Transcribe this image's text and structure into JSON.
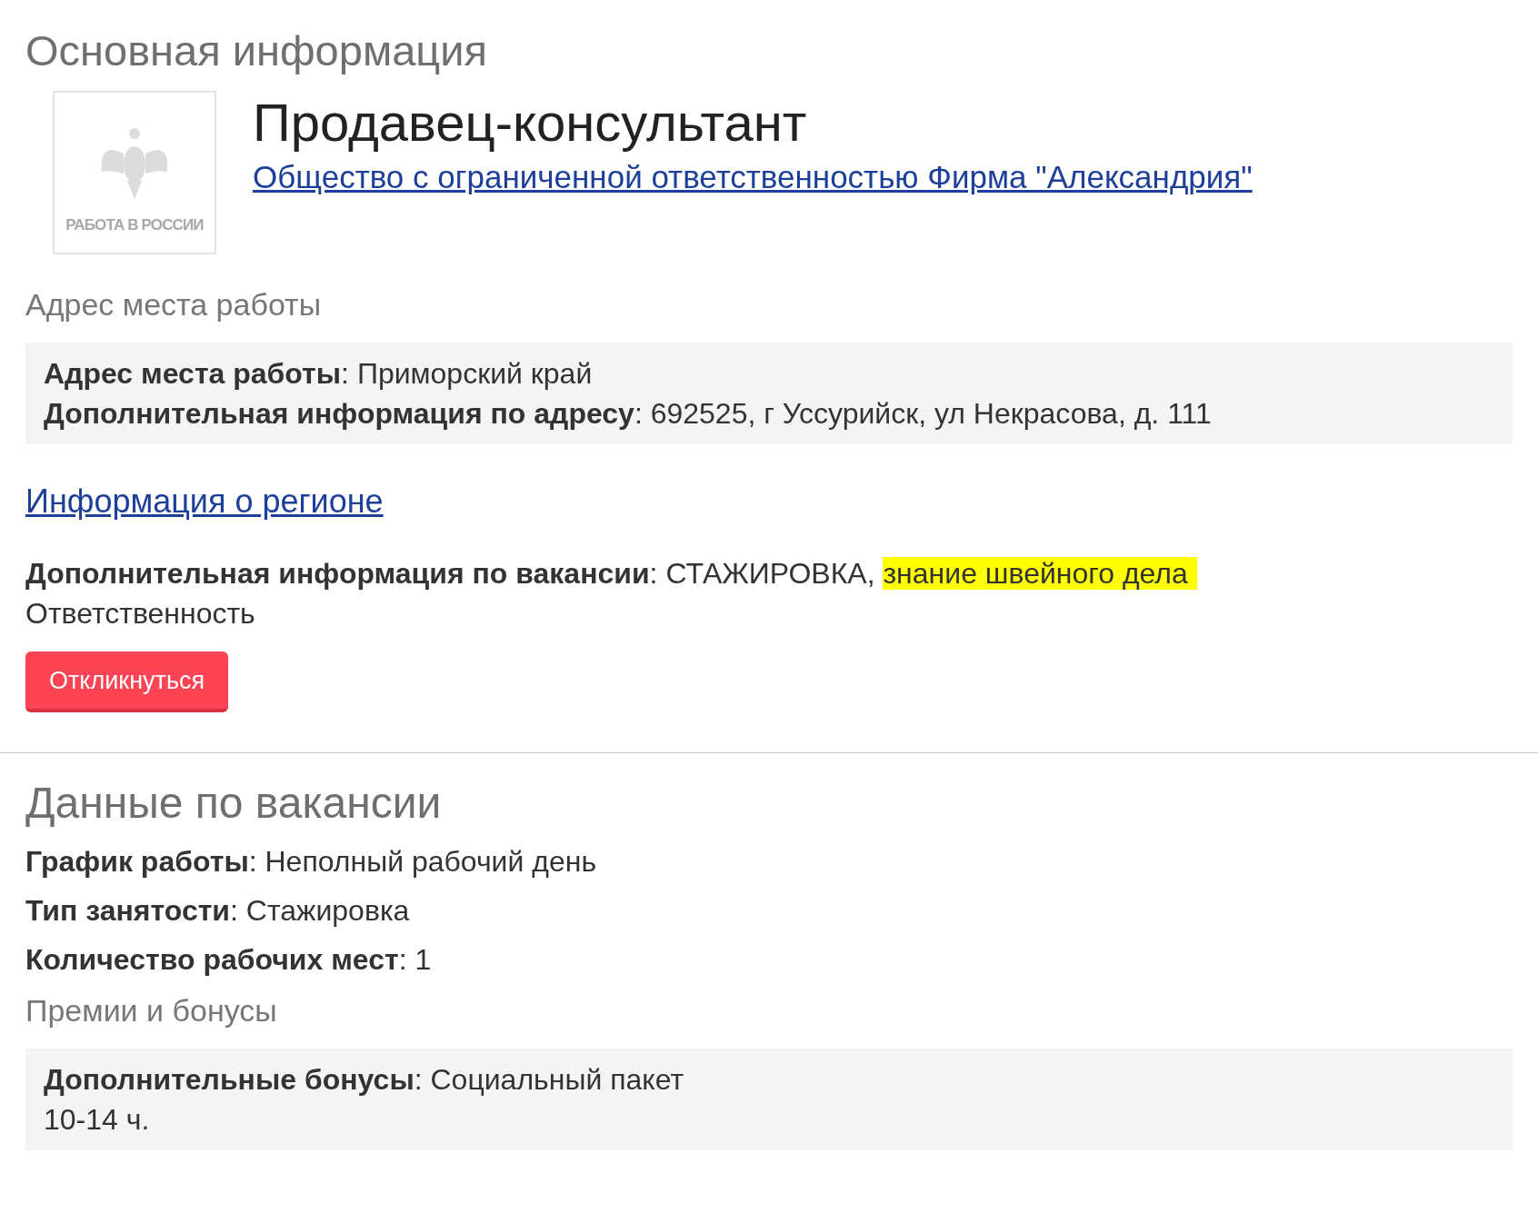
{
  "main_title": "Основная информация",
  "logo": {
    "caption": "РАБОТА В РОССИИ"
  },
  "job_title": "Продавец-консультант",
  "company_link": "Общество с ограниченной ответственностью Фирма \"Александрия\"",
  "address_heading": "Адрес места работы",
  "address_fields": [
    "**Адрес места работы**: Приморский край",
    "**Дополнительная информация по адресу**: 692525, г Уссурийск, ул Некрасова, д. 111"
  ],
  "region_link": "Информация о регионе",
  "extra_info": {
    "text": "**Дополнительная информация по вакансии**: СТАЖИРОВКА, ",
    "highlighted": "знание швейного дела ",
    "next_line": "Ответственность"
  },
  "respond_button": "Откликнуться",
  "vacancy_heading": "Данные по вакансии",
  "vacancy_fields": [
    "**График работы**: Неполный рабочий день",
    "**Тип занятости**: Стажировка",
    "**Количество рабочих мест**: 1"
  ],
  "bonus_heading": "Премии и бонусы",
  "bonus_lines": [
    "**Дополнительные бонусы**: Социальный пакет",
    "10-14 ч."
  ]
}
